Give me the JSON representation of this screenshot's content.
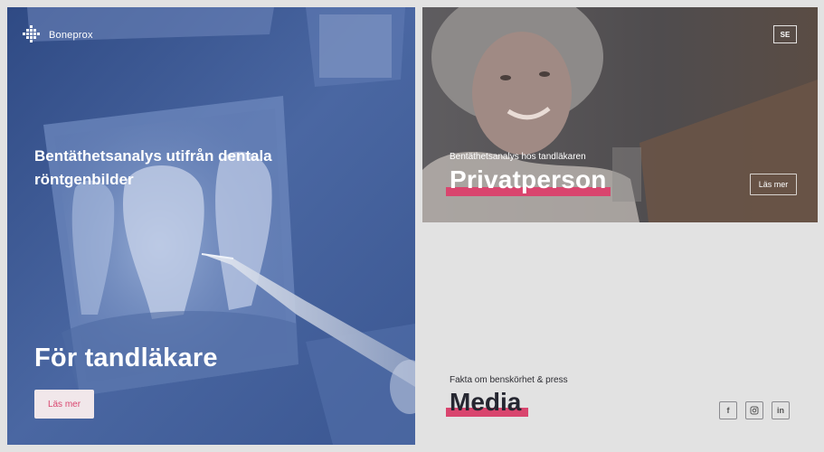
{
  "brand": {
    "name": "Boneprox"
  },
  "dentists": {
    "heading": "Bentäthetsanalys utifrån dentala röntgenbilder",
    "title": "För tandläkare",
    "button": "Läs mer"
  },
  "private": {
    "language": "SE",
    "subtitle": "Bentäthetsanalys hos tandläkaren",
    "title": "Privatperson",
    "button": "Läs mer"
  },
  "media": {
    "subtitle": "Fakta om benskörhet & press",
    "title": "Media",
    "social": [
      {
        "icon": "facebook-icon",
        "label": "f"
      },
      {
        "icon": "instagram-icon",
        "label": ""
      },
      {
        "icon": "linkedin-icon",
        "label": "in"
      }
    ]
  },
  "colors": {
    "accent": "#d9456e",
    "left_overlay": "#3d5a92",
    "dark_text": "#252630",
    "background": "#e2e2e2"
  }
}
